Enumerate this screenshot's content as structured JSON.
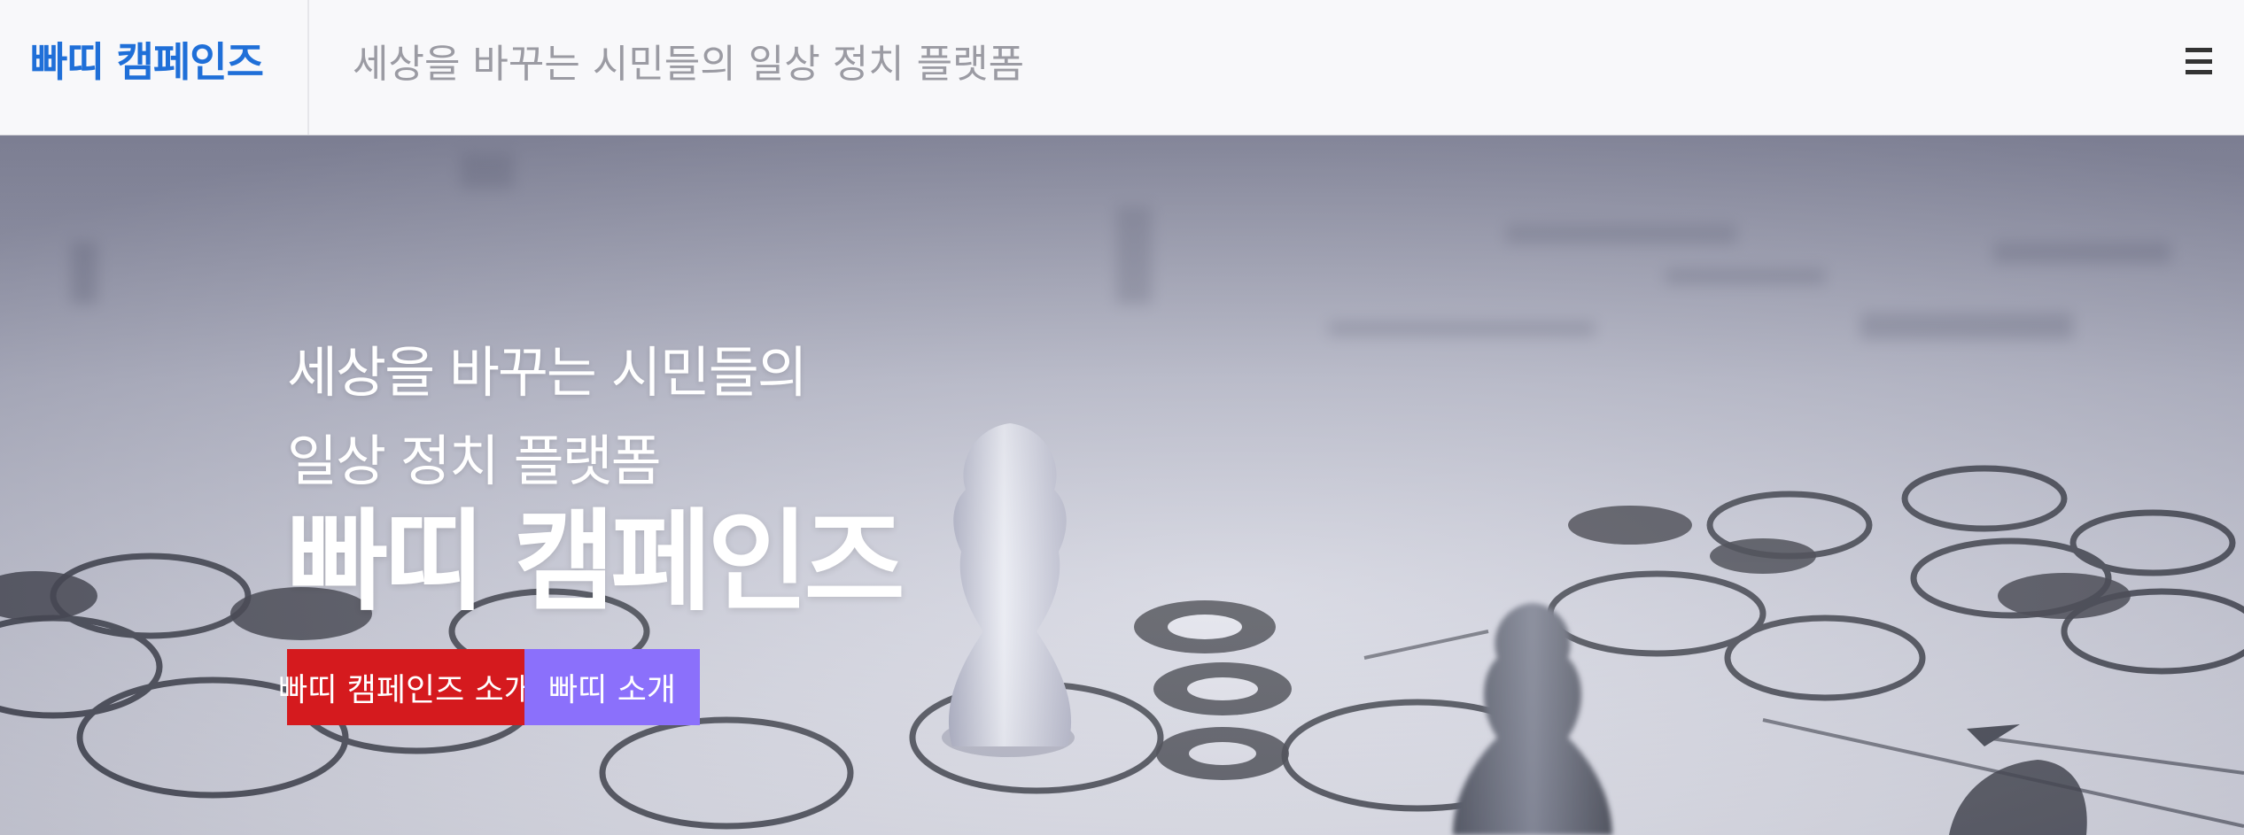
{
  "header": {
    "brand": "빠띠 캠페인즈",
    "tagline": "세상을 바꾸는 시민들의 일상 정치 플랫폼",
    "menu_icon": "hamburger-menu-icon"
  },
  "hero": {
    "subtitle_line1": "세상을 바꾸는 시민들의",
    "subtitle_line2": "일상 정치 플랫폼",
    "title": "빠띠 캠페인즈",
    "buttons": {
      "primary_label": "빠띠 캠페인즈 소개",
      "secondary_label": "빠띠 소개"
    }
  },
  "colors": {
    "brand": "#1f6fd8",
    "primary_button": "#d51a1e",
    "secondary_button": "#8b70fb"
  }
}
